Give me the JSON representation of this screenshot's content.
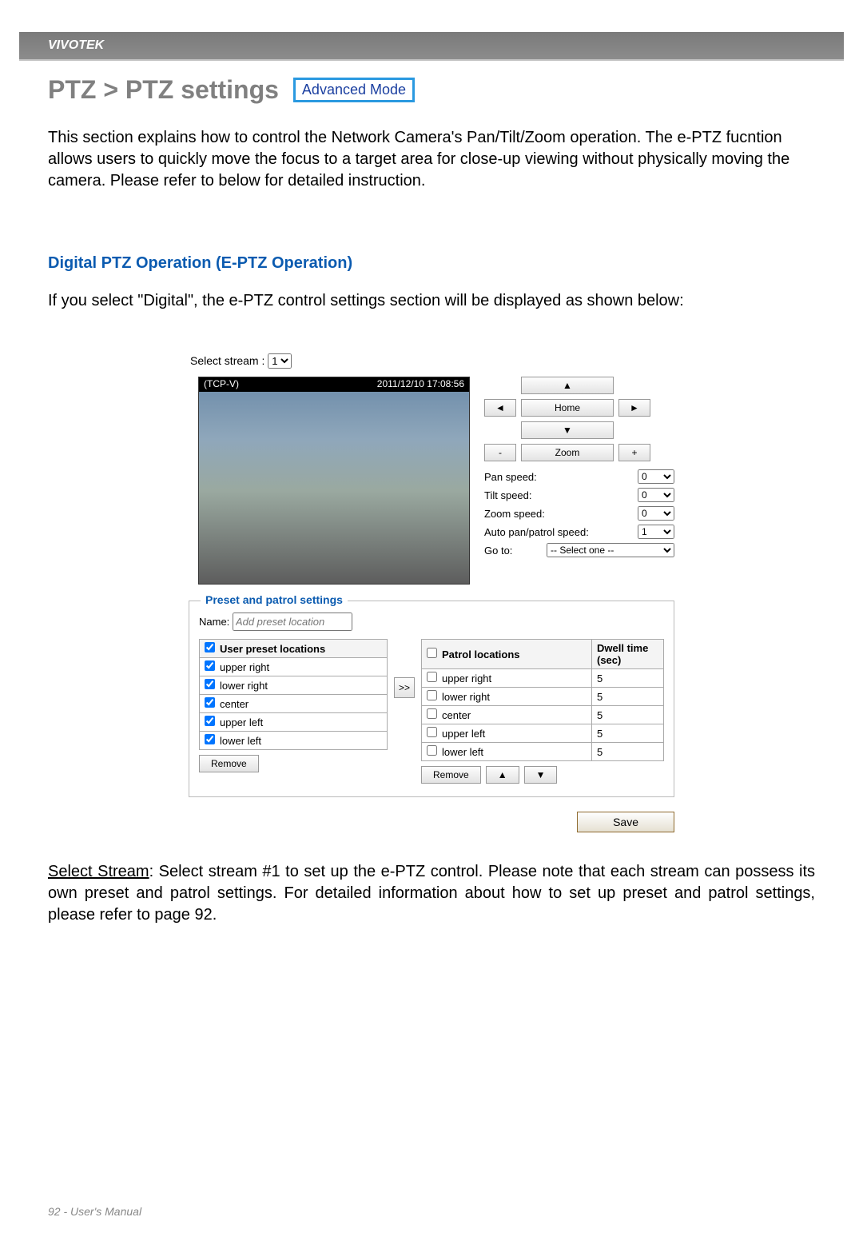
{
  "brand": "VIVOTEK",
  "page_title": "PTZ > PTZ settings",
  "mode_badge": "Advanced Mode",
  "intro": "This section explains how to control the Network Camera's Pan/Tilt/Zoom operation. The e-PTZ fucntion allows users to quickly move the focus to a target area for close-up viewing without physically moving the camera. Please refer to below for detailed instruction.",
  "subheading": "Digital PTZ Operation (E-PTZ Operation)",
  "subintro": "If you select \"Digital\", the e-PTZ control settings section will be displayed as shown below:",
  "figure": {
    "select_stream_label": "Select stream :",
    "select_stream_value": "1",
    "video_overlay_left": "(TCP-V)",
    "video_overlay_right": "2011/12/10  17:08:56",
    "controls": {
      "up": "▲",
      "down": "▼",
      "left": "◄",
      "right": "►",
      "home": "Home",
      "zoom_label": "Zoom",
      "zoom_out": "-",
      "zoom_in": "+",
      "pan_speed_label": "Pan speed:",
      "pan_speed_value": "0",
      "tilt_speed_label": "Tilt speed:",
      "tilt_speed_value": "0",
      "zoom_speed_label": "Zoom speed:",
      "zoom_speed_value": "0",
      "auto_speed_label": "Auto pan/patrol speed:",
      "auto_speed_value": "1",
      "goto_label": "Go to:",
      "goto_value": "-- Select one --"
    },
    "preset": {
      "legend": "Preset and patrol settings",
      "name_label": "Name:",
      "name_placeholder": "Add preset location",
      "user_header": "User preset locations",
      "user_items": [
        "upper right",
        "lower right",
        "center",
        "upper left",
        "lower left"
      ],
      "patrol_header": "Patrol locations",
      "dwell_header_1": "Dwell time",
      "dwell_header_2": "(sec)",
      "patrol_items": [
        {
          "name": "upper right",
          "dwell": "5"
        },
        {
          "name": "lower right",
          "dwell": "5"
        },
        {
          "name": "center",
          "dwell": "5"
        },
        {
          "name": "upper left",
          "dwell": "5"
        },
        {
          "name": "lower left",
          "dwell": "5"
        }
      ],
      "transfer_btn": ">>",
      "remove_btn": "Remove",
      "up_btn": "▲",
      "down_btn": "▼",
      "save_btn": "Save"
    }
  },
  "bottom_note_label": "Select Stream",
  "bottom_note_rest": ": Select stream #1 to set up the e-PTZ control. Please note that each stream can possess its own preset and patrol settings. For detailed information about how to set up preset and patrol settings, please refer to page 92.",
  "footer": "92 - User's Manual"
}
